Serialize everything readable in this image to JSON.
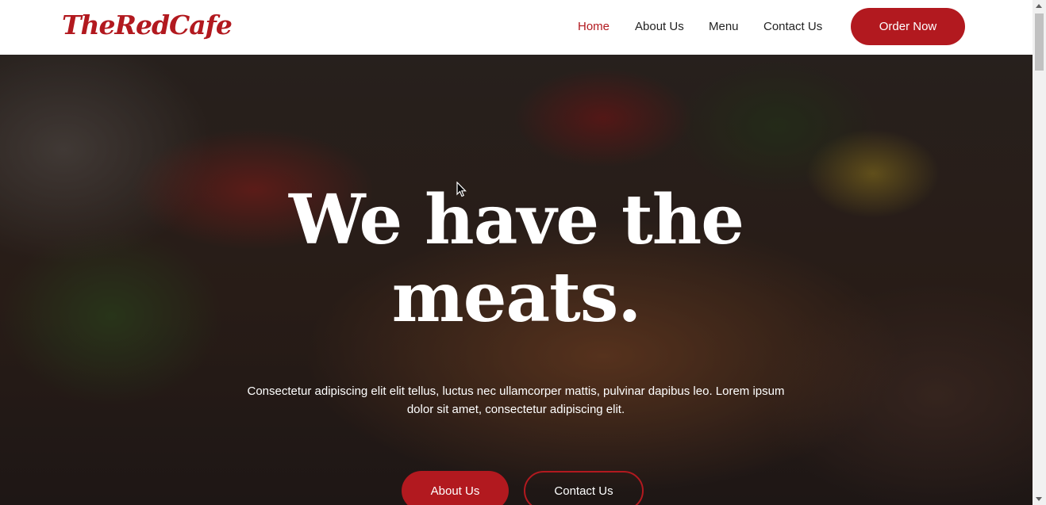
{
  "header": {
    "logo_text": "TheRedCafe",
    "nav": [
      {
        "label": "Home",
        "active": true
      },
      {
        "label": "About Us",
        "active": false
      },
      {
        "label": "Menu",
        "active": false
      },
      {
        "label": "Contact Us",
        "active": false
      }
    ],
    "cta_label": "Order Now"
  },
  "hero": {
    "title_line1": "We have the",
    "title_line2": "meats.",
    "description": "Consectetur adipiscing elit elit tellus, luctus nec ullamcorper mattis, pulvinar dapibus leo. Lorem ipsum dolor sit amet, consectetur adipiscing elit.",
    "buttons": [
      {
        "label": "About Us"
      },
      {
        "label": "Contact Us"
      }
    ]
  },
  "colors": {
    "accent": "#b2191f",
    "nav_text": "#222222",
    "header_bg": "#ffffff",
    "hero_text": "#ffffff"
  },
  "icons": {
    "cursor": "pointer-cursor-icon",
    "scroll_up": "chevron-up-icon",
    "scroll_down": "chevron-down-icon"
  }
}
